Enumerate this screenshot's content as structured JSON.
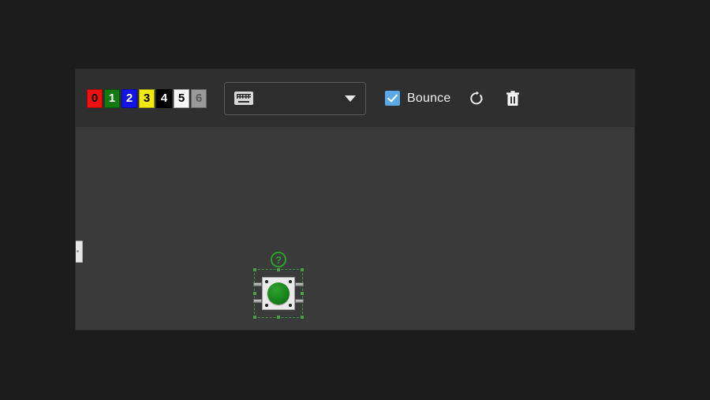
{
  "window": {
    "background_color": "#343434",
    "desktop_color": "#1c1c1c"
  },
  "toolbar": {
    "background_color": "#2f2f2f",
    "palette": {
      "name": "color-palette",
      "swatches": [
        {
          "index": "0",
          "label": "0",
          "fill": "#ee1111",
          "text_color": "#000000",
          "name": "red"
        },
        {
          "index": "1",
          "label": "1",
          "fill": "#137a13",
          "text_color": "#ffffff",
          "name": "green"
        },
        {
          "index": "2",
          "label": "2",
          "fill": "#1414e6",
          "text_color": "#ffffff",
          "name": "blue"
        },
        {
          "index": "3",
          "label": "3",
          "fill": "#f2e810",
          "text_color": "#000000",
          "name": "yellow"
        },
        {
          "index": "4",
          "label": "4",
          "fill": "#000000",
          "text_color": "#ffffff",
          "name": "black"
        },
        {
          "index": "5",
          "label": "5",
          "fill": "#f7f7f7",
          "text_color": "#000000",
          "name": "white"
        },
        {
          "index": "6",
          "label": "6",
          "fill": "#9a9a9a",
          "text_color": "#5a5a5a",
          "name": "gray"
        }
      ]
    },
    "dropdown": {
      "selected_icon": "keyboard-icon",
      "selected_label": "",
      "caret_icon": "chevron-down-icon"
    },
    "bounce": {
      "label": "Bounce",
      "checked": true,
      "accent_color": "#5aa9e6"
    },
    "rotate_button": {
      "icon": "rotate-icon",
      "label": ""
    },
    "delete_button": {
      "icon": "trash-icon",
      "label": ""
    }
  },
  "canvas": {
    "background_color": "#3a3a3a",
    "panel_handle": {
      "name": "left-panel-handle"
    },
    "component": {
      "name": "pushbutton-component",
      "type": "pushbutton",
      "badge": "?",
      "badge_color": "#2f9e2f",
      "dome_color": "#17801a",
      "selected": true,
      "pin_count": 4
    }
  }
}
